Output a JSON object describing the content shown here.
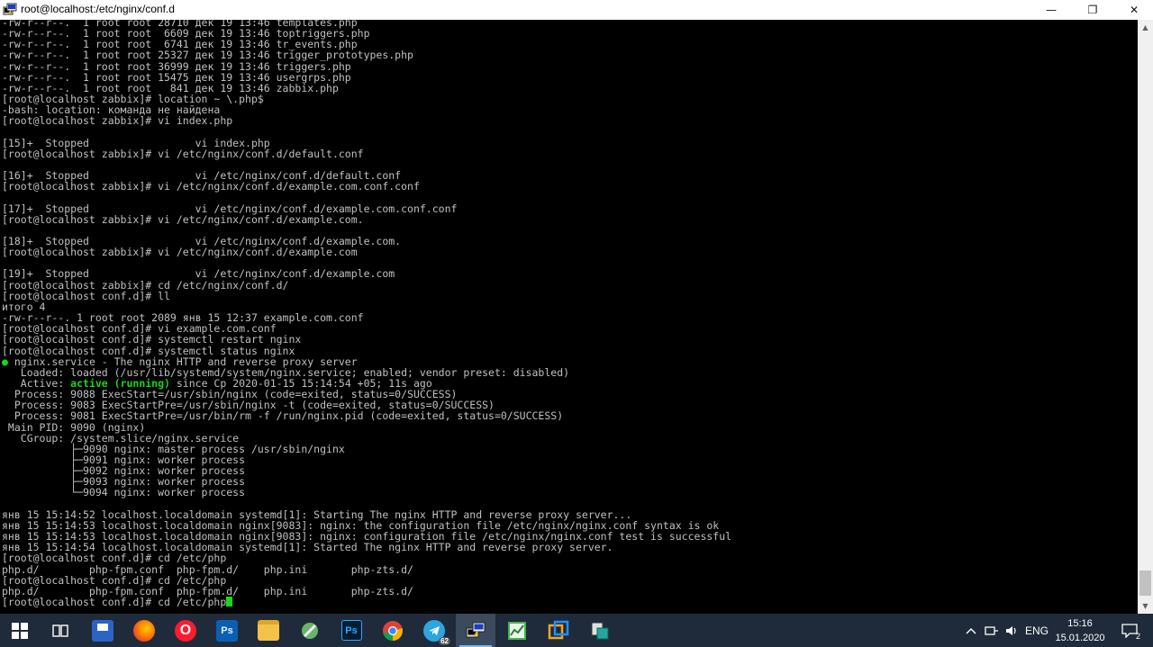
{
  "window": {
    "title": "root@localhost:/etc/nginx/conf.d",
    "minimize_glyph": "—",
    "maximize_glyph": "❐",
    "close_glyph": "✕"
  },
  "terminal": {
    "lines": [
      "-rw-r--r--.  1 root root 28710 дек 19 13:46 templates.php",
      "-rw-r--r--.  1 root root  6609 дек 19 13:46 toptriggers.php",
      "-rw-r--r--.  1 root root  6741 дек 19 13:46 tr_events.php",
      "-rw-r--r--.  1 root root 25327 дек 19 13:46 trigger_prototypes.php",
      "-rw-r--r--.  1 root root 36999 дек 19 13:46 triggers.php",
      "-rw-r--r--.  1 root root 15475 дек 19 13:46 usergrps.php",
      "-rw-r--r--.  1 root root   841 дек 19 13:46 zabbix.php",
      "[root@localhost zabbix]# location ~ \\.php$",
      "-bash: location: команда не найдена",
      "[root@localhost zabbix]# vi index.php",
      "",
      "[15]+  Stopped                 vi index.php",
      "[root@localhost zabbix]# vi /etc/nginx/conf.d/default.conf",
      "",
      "[16]+  Stopped                 vi /etc/nginx/conf.d/default.conf",
      "[root@localhost zabbix]# vi /etc/nginx/conf.d/example.com.conf.conf",
      "",
      "[17]+  Stopped                 vi /etc/nginx/conf.d/example.com.conf.conf",
      "[root@localhost zabbix]# vi /etc/nginx/conf.d/example.com.",
      "",
      "[18]+  Stopped                 vi /etc/nginx/conf.d/example.com.",
      "[root@localhost zabbix]# vi /etc/nginx/conf.d/example.com",
      "",
      "[19]+  Stopped                 vi /etc/nginx/conf.d/example.com",
      "[root@localhost zabbix]# cd /etc/nginx/conf.d/",
      "[root@localhost conf.d]# ll",
      "итого 4",
      "-rw-r--r--. 1 root root 2089 янв 15 12:37 example.com.conf",
      "[root@localhost conf.d]# vi example.com.conf",
      "[root@localhost conf.d]# systemctl restart nginx",
      "[root@localhost conf.d]# systemctl status nginx"
    ],
    "status": {
      "dot": "●",
      "service_line": " nginx.service - The nginx HTTP and reverse proxy server",
      "loaded_line": "   Loaded: loaded (/usr/lib/systemd/system/nginx.service; enabled; vendor preset: disabled)",
      "active_prefix": "   Active: ",
      "active_state": "active (running)",
      "active_suffix": " since Ср 2020-01-15 15:14:54 +05; 11s ago"
    },
    "lines_after": [
      "  Process: 9088 ExecStart=/usr/sbin/nginx (code=exited, status=0/SUCCESS)",
      "  Process: 9083 ExecStartPre=/usr/sbin/nginx -t (code=exited, status=0/SUCCESS)",
      "  Process: 9081 ExecStartPre=/usr/bin/rm -f /run/nginx.pid (code=exited, status=0/SUCCESS)",
      " Main PID: 9090 (nginx)",
      "   CGroup: /system.slice/nginx.service",
      "           ├─9090 nginx: master process /usr/sbin/nginx",
      "           ├─9091 nginx: worker process",
      "           ├─9092 nginx: worker process",
      "           ├─9093 nginx: worker process",
      "           └─9094 nginx: worker process",
      "",
      "янв 15 15:14:52 localhost.localdomain systemd[1]: Starting The nginx HTTP and reverse proxy server...",
      "янв 15 15:14:53 localhost.localdomain nginx[9083]: nginx: the configuration file /etc/nginx/nginx.conf syntax is ok",
      "янв 15 15:14:53 localhost.localdomain nginx[9083]: nginx: configuration file /etc/nginx/nginx.conf test is successful",
      "янв 15 15:14:54 localhost.localdomain systemd[1]: Started The nginx HTTP and reverse proxy server.",
      "[root@localhost conf.d]# cd /etc/php",
      "php.d/        php-fpm.conf  php-fpm.d/    php.ini       php-zts.d/",
      "[root@localhost conf.d]# cd /etc/php",
      "php.d/        php-fpm.conf  php-fpm.d/    php.ini       php-zts.d/"
    ],
    "prompt_line": "[root@localhost conf.d]# cd /etc/php",
    "green_color": "#16d916",
    "text_color": "#c0c0c0"
  },
  "taskbar": {
    "items": [
      {
        "name": "windows-start-icon",
        "label": ""
      },
      {
        "name": "task-view-icon",
        "label": ""
      },
      {
        "name": "floppy-disk-app-icon",
        "label": ""
      },
      {
        "name": "firefox-icon",
        "label": ""
      },
      {
        "name": "opera-icon",
        "label": "O"
      },
      {
        "name": "photoshop-icon",
        "label": "Ps"
      },
      {
        "name": "file-explorer-icon",
        "label": ""
      },
      {
        "name": "tool-app-icon",
        "label": ""
      },
      {
        "name": "photoshop-dark-icon",
        "label": "Ps"
      },
      {
        "name": "chrome-icon",
        "label": ""
      },
      {
        "name": "telegram-icon",
        "label": "62"
      },
      {
        "name": "putty-icon",
        "label": ""
      },
      {
        "name": "chart-app-icon",
        "label": ""
      },
      {
        "name": "orange-window-app-icon",
        "label": ""
      },
      {
        "name": "teal-app-icon",
        "label": ""
      }
    ],
    "tray": {
      "chevron": "^",
      "language": "ENG",
      "time": "15:16",
      "date": "15.01.2020",
      "notifications": "2"
    }
  }
}
